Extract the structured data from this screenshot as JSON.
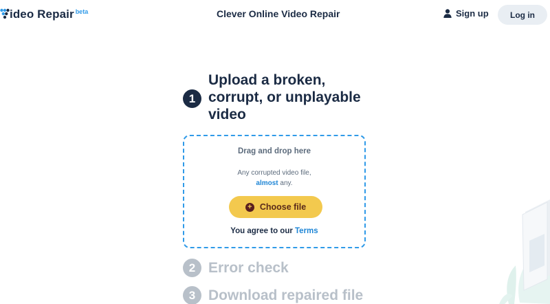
{
  "header": {
    "logo_text": "ideo Repair",
    "logo_badge": "beta",
    "site_title": "Clever Online Video Repair",
    "signup_label": "Sign up",
    "login_label": "Log in"
  },
  "steps": [
    {
      "number": "1",
      "title": "Upload a broken, corrupt, or unplayable video",
      "active": true
    },
    {
      "number": "2",
      "title": "Error check",
      "active": false
    },
    {
      "number": "3",
      "title": "Download repaired file",
      "active": false
    }
  ],
  "dropzone": {
    "title": "Drag and drop here",
    "desc_line1": "Any corrupted video file,",
    "desc_highlight": "almost",
    "desc_line2_rest": " any.",
    "button_label": "Choose file",
    "terms_prefix": "You agree to our ",
    "terms_link": "Terms"
  },
  "icons": {
    "logo": "logo-dots-icon",
    "signup": "user-icon",
    "choose": "plus-circle-icon"
  },
  "colors": {
    "primary_text": "#1b2b44",
    "accent_blue": "#2f9ae8",
    "button_yellow": "#f3c94e",
    "inactive_grey": "#b8c0c9"
  }
}
